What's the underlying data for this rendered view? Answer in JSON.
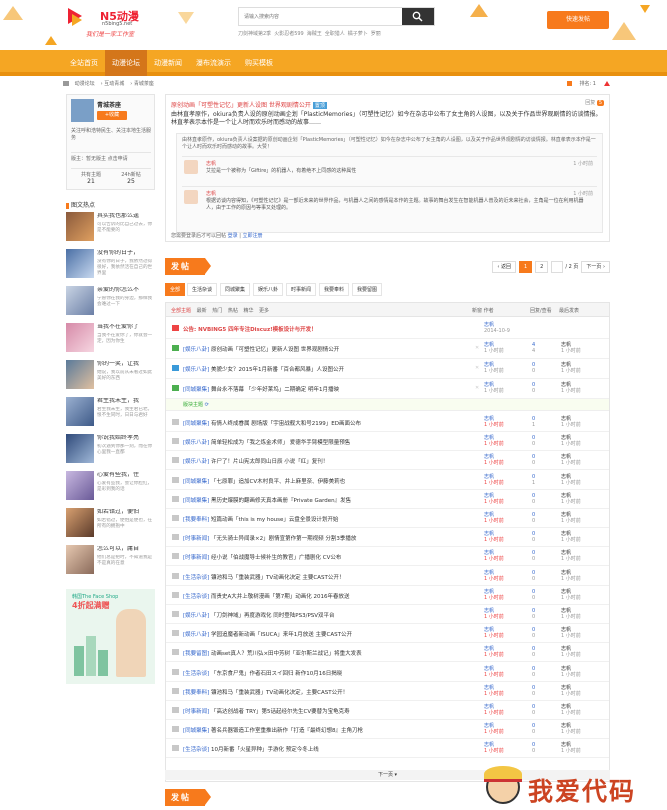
{
  "header": {
    "logo_text": "N5动漫",
    "logo_domain": "n5bing5.net",
    "logo_slogan": "我们是一家工作室",
    "search_placeholder": "请输入搜索内容",
    "hot_words": [
      "刀剑神域第2季",
      "火影忍者599",
      "海贼王",
      "全职猎人",
      "橘子萝卜",
      "罗丽"
    ],
    "post_button": "快速发帖"
  },
  "nav": {
    "items": [
      "全站首页",
      "动漫论坛",
      "动漫新闻",
      "瀑布流演示",
      "购买模板"
    ],
    "active_index": 1
  },
  "breadcrumb": {
    "items": [
      "动漫论坛",
      "互动青城",
      "青城茶座"
    ],
    "right_label": "排名: 1"
  },
  "sidebar": {
    "forum_name": "青城茶座",
    "fav_button": "+收藏",
    "forum_desc": "关注呼和浩特民生、关注本地生活服务",
    "moderator": "版主：暂无版主 点击申请",
    "stats": [
      {
        "label": "共有主题",
        "value": "21"
      },
      {
        "label": "24h新帖",
        "value": "25"
      }
    ],
    "section_title": "图文热点",
    "items": [
      {
        "title": "其实我也那么逞",
        "sub": "可以告诉的比自己过去，你是不能要的"
      },
      {
        "title": "没有你的日子，",
        "sub": "没有你的日子，我依然过得很好，我依然活在自己的世界里"
      },
      {
        "title": "亲爱的你怎么不",
        "sub": "宁愿你在我的身边，那样我会难过一下"
      },
      {
        "title": "当我不在爱你了",
        "sub": "当我不在爱你了，你就会一定，因为你生"
      },
      {
        "title": "你的一笑，让我",
        "sub": "她说，我以前从未看过如此美好的东西"
      },
      {
        "title": "君生我未生，我",
        "sub": "君生我未生，我生君已老。恨不生同时，日日与君好"
      },
      {
        "title": "你说我始终孝亮",
        "sub": "初次遇到你那一刻，而在你心里我一直都"
      },
      {
        "title": "心爱有些我，住",
        "sub": "心爱有些我，会让你脸红，是彩到我的话"
      },
      {
        "title": "如若错过，便怕",
        "sub": "如若错过，便怕是便也，在所有的拥抱中"
      },
      {
        "title": "怎么可以，庸自",
        "sub": "他们总是把时，不知道我是不是真的在意"
      }
    ],
    "ad": {
      "brand": "韩国The Face Shop",
      "headline": "4折起满赠"
    }
  },
  "intro": {
    "title": "原创动画「可塑性记忆」更新人设图 世界观剧情公开",
    "tag": "置顶",
    "reply_label": "回复",
    "reply_count": "5",
    "text": "由林直孝原作，okiura负责人设的原创动画企划「PlasticMemories」（可塑性记忆）如今在杂志中公布了女主角的人设图，以及关于作品世界观剧情的访谈情报。林直孝表示本作是一个让人时而欢乐时而感动的故事……",
    "quote": "由林直孝原作，okiura负责人设案据的原创动画企划「PlasticMemories」（可塑性记忆）如今在杂志中公布了女主角的人设图，以及关于作品世界观剧情的访谈情报。林直孝表示本作是一个让人时而欢乐时而感动的故事。大赞！",
    "comments": [
      {
        "author": "志帆",
        "time": "1 小时前",
        "text": "艾拉是一个被称为「Giftire」的机器人，有着绝不上同感的这种属性"
      },
      {
        "author": "志帆",
        "time": "1 小时前",
        "text": "根据访谈内容得知，《可塑性记忆》是一部近未来的世界作品，与机器人之间的感情是本作的主题。故事的舞台发生在智能机器人普及的近未来社会，主角是一位在利用机器人，由于工作的原因与等事又处理的。"
      }
    ],
    "footer_prefix": "您需要登录后才可以回帖",
    "login_link": "登录",
    "register_link": "立即注册"
  },
  "post_button_label": "发帖",
  "pager": {
    "prev": "‹ 返回",
    "pages": [
      "1",
      "2"
    ],
    "current": "1",
    "total_label": "/ 2 页",
    "next": "下一页 ›"
  },
  "filter_tabs": [
    "全部",
    "生活杂谈",
    "同城聚集",
    "娱乐八卦",
    "时事新闻",
    "我要奉料",
    "我要留图"
  ],
  "list_header": {
    "left": [
      "全部主题",
      "最新",
      "热门",
      "热帖",
      "精华",
      "更多"
    ],
    "col_new": "新窗",
    "col_author": "作者",
    "col_reply": "回复/查看",
    "col_last": "最后发表"
  },
  "sticky": {
    "title": "公告: NVBING5 四年专注Discuz!模板设计与开发！",
    "author": "志帆",
    "date": "2014-10-9"
  },
  "top_threads": [
    {
      "cat": "[娱乐八卦]",
      "title": "原创动画「可塑性记忆」更新人设图 世界观剧情公开",
      "author": "志帆",
      "date": "1 小时前",
      "replies": "4",
      "views": "4",
      "last": "志帆",
      "last_date": "1 小时前",
      "icon": "green"
    },
    {
      "cat": "[娱乐八卦]",
      "title": "美貌少女？2015年1月新番「百合都风暴」人设图公开",
      "author": "志帆",
      "date": "1 小时前",
      "replies": "0",
      "views": "0",
      "last": "志帆",
      "last_date": "1 小时前",
      "icon": "blue"
    },
    {
      "cat": "[同城聚集]",
      "title": "舞台永不落幕 「少年好莱坞」二期确定 明年1月播映",
      "author": "志帆",
      "date": "1 小时前",
      "replies": "0",
      "views": "0",
      "last": "志帆",
      "last_date": "1 小时前",
      "icon": "green"
    }
  ],
  "divider_label": "版块主题",
  "threads": [
    {
      "cat": "[同城聚集]",
      "title": "有情人终成眷属 剧场版「宇宙战舰大和号2199」ED画面公布",
      "author": "志帆",
      "date": "1 小时前",
      "replies": "0",
      "views": "1",
      "last": "志帆",
      "last_date": "1 小时前"
    },
    {
      "cat": "[娱乐八卦]",
      "title": "简单轻松成为「我之炼金术师」 爱德华手臂模型限量预售",
      "author": "志帆",
      "date": "1 小时前",
      "replies": "0",
      "views": "0",
      "last": "志帆",
      "last_date": "1 小时前"
    },
    {
      "cat": "[娱乐八卦]",
      "title": "许尸了！片山宪太郎同山日辰 小说「红」复刊！",
      "author": "志帆",
      "date": "1 小时前",
      "replies": "0",
      "views": "0",
      "last": "志帆",
      "last_date": "1 小时前"
    },
    {
      "cat": "[同城聚集]",
      "title": "「七原罪」追加CV木村良平、井上麻里奈、伊藤美莉也",
      "author": "志帆",
      "date": "1 小时前",
      "replies": "0",
      "views": "1",
      "last": "志帆",
      "last_date": "1 小时前"
    },
    {
      "cat": "[同城聚集]",
      "title": "黑历史爆膜的翻画修天真本画册『Private Garden』发售",
      "author": "志帆",
      "date": "1 小时前",
      "replies": "0",
      "views": "0",
      "last": "志帆",
      "last_date": "1 小时前"
    },
    {
      "cat": "[我要奉料]",
      "title": "短篇动画「this is my house」云盘全景设计划开始",
      "author": "志帆",
      "date": "1 小时前",
      "replies": "0",
      "views": "0",
      "last": "志帆",
      "last_date": "1 小时前"
    },
    {
      "cat": "[时事新闻]",
      "title": "「无头骑士异闻录×2」剧情宣第作第一期视频 分割3季播放",
      "author": "志帆",
      "date": "1 小时前",
      "replies": "0",
      "views": "0",
      "last": "志帆",
      "last_date": "1 小时前"
    },
    {
      "cat": "[时事新闻]",
      "title": "经小说「伯战魔导士候补生的教官」广播剧化 CV公布",
      "author": "志帆",
      "date": "1 小时前",
      "replies": "0",
      "views": "0",
      "last": "志帆",
      "last_date": "1 小时前"
    },
    {
      "cat": "[生活杂谈]",
      "title": "镰池和马「重装武器」TV动画化决定 主要CAST公开！",
      "author": "志帆",
      "date": "1 小时前",
      "replies": "0",
      "views": "0",
      "last": "志帆",
      "last_date": "1 小时前"
    },
    {
      "cat": "[生活杂谈]",
      "title": "而贵史A大井上敬树漫画「第7期」动画化 2016年春放送",
      "author": "志帆",
      "date": "1 小时前",
      "replies": "0",
      "views": "0",
      "last": "志帆",
      "last_date": "1 小时前"
    },
    {
      "cat": "[娱乐八卦]",
      "title": "「刀剑神域」再度游戏化 同时登陆PS3/PSV双平台",
      "author": "志帆",
      "date": "1 小时前",
      "replies": "0",
      "views": "0",
      "last": "志帆",
      "last_date": "1 小时前"
    },
    {
      "cat": "[娱乐八卦]",
      "title": "学园追魔者新动画「ISUCA」来年1月放送 主要CAST公开",
      "author": "志帆",
      "date": "1 小时前",
      "replies": "0",
      "views": "0",
      "last": "志帆",
      "last_date": "1 小时前"
    },
    {
      "cat": "[我要留图]",
      "title": "动画set真人？荒川弘×田中芳树「亚尔斯兰战记」将重大发表",
      "author": "志帆",
      "date": "1 小时前",
      "replies": "0",
      "views": "0",
      "last": "志帆",
      "last_date": "1 小时前"
    },
    {
      "cat": "[生活杂谈]",
      "title": "「东京食尸鬼」作者石田スイ回归 新作10月16日揭晓",
      "author": "志帆",
      "date": "1 小时前",
      "replies": "0",
      "views": "0",
      "last": "志帆",
      "last_date": "1 小时前"
    },
    {
      "cat": "[我要奉料]",
      "title": "镰池和马「重装武器」TV动画化决定，主要CAST公开！",
      "author": "志帆",
      "date": "1 小时前",
      "replies": "0",
      "views": "0",
      "last": "志帆",
      "last_date": "1 小时前"
    },
    {
      "cat": "[时事新闻]",
      "title": "「高达创战者 TRY」第5话起经尔先生CV要替为宝龟克寿",
      "author": "志帆",
      "date": "1 小时前",
      "replies": "0",
      "views": "0",
      "last": "志帆",
      "last_date": "1 小时前"
    },
    {
      "cat": "[同城聚集]",
      "title": "著名兵器锻造工作室重推出新作「打造『最终幻想8』主角刀枪",
      "author": "志帆",
      "date": "1 小时前",
      "replies": "0",
      "views": "0",
      "last": "志帆",
      "last_date": "1 小时前"
    },
    {
      "cat": "[生活杂谈]",
      "title": "10月新番「火星异种」手游化 预定今冬上线",
      "author": "志帆",
      "date": "1 小时前",
      "replies": "0",
      "views": "0",
      "last": "志帆",
      "last_date": "1 小时前"
    }
  ],
  "next_page_label": "下一页 ▾",
  "watermark": "我爱代码",
  "colors": {
    "accent": "#f77a1c",
    "nav": "#f5a623",
    "link": "#3366cc",
    "red": "#dd4444"
  }
}
